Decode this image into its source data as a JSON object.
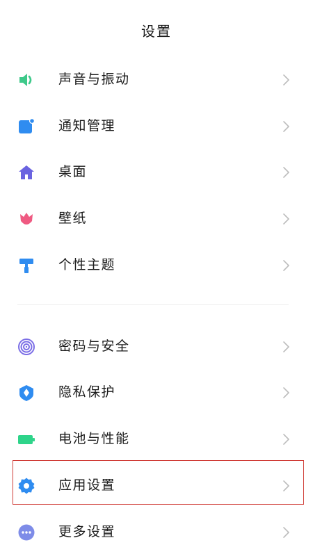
{
  "header": {
    "title": "设置"
  },
  "settings": {
    "group1": [
      {
        "label": "声音与振动",
        "icon": "speaker-icon",
        "color": "#3ec98a"
      },
      {
        "label": "通知管理",
        "icon": "notification-icon",
        "color": "#2f8cf0"
      },
      {
        "label": "桌面",
        "icon": "home-icon",
        "color": "#6a63e0"
      },
      {
        "label": "壁纸",
        "icon": "tulip-icon",
        "color": "#ef5a82"
      },
      {
        "label": "个性主题",
        "icon": "paint-roller-icon",
        "color": "#2f8cf0"
      }
    ],
    "group2": [
      {
        "label": "密码与安全",
        "icon": "fingerprint-icon",
        "color": "#7b6ee6"
      },
      {
        "label": "隐私保护",
        "icon": "shield-icon",
        "color": "#2f8cf0"
      },
      {
        "label": "电池与性能",
        "icon": "battery-icon",
        "color": "#2ed48a"
      },
      {
        "label": "应用设置",
        "icon": "gear-icon",
        "color": "#2f8cf0",
        "highlighted": true
      },
      {
        "label": "更多设置",
        "icon": "more-icon",
        "color": "#7e8ce8"
      }
    ]
  },
  "colors": {
    "highlight_border": "#cf3b35",
    "chevron": "#bdbdbd",
    "text": "#1a1a1a"
  }
}
